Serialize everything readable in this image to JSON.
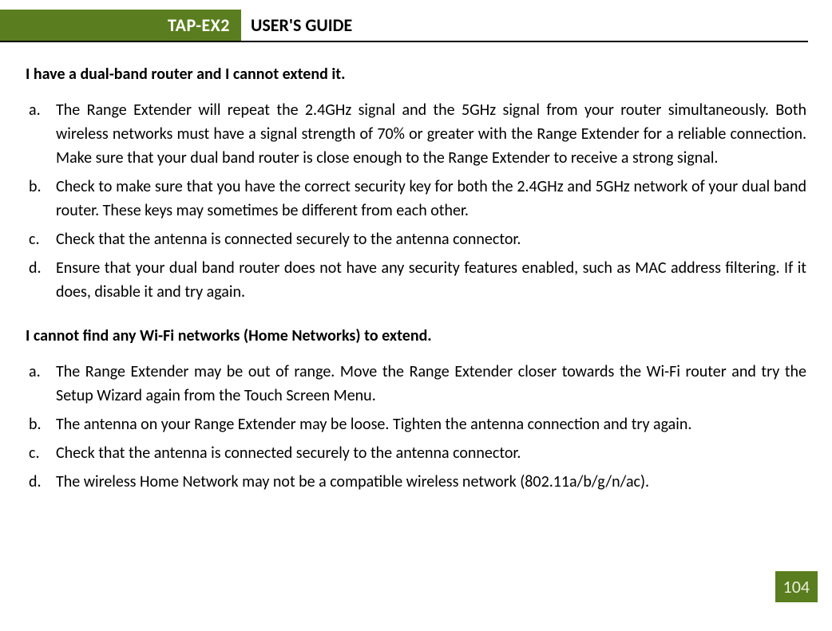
{
  "header": {
    "product": "TAP-EX2",
    "title": "USER'S GUIDE"
  },
  "sections": [
    {
      "heading": "I have a dual-band router and I cannot extend it.",
      "items": [
        {
          "marker": "a.",
          "text": "The Range Extender will repeat the 2.4GHz signal and the 5GHz signal from your router simultaneously. Both wireless networks must have a signal strength of 70% or greater with the Range Extender for a reliable connection. Make sure that your dual band router is close enough to the Range Extender to receive a strong signal."
        },
        {
          "marker": "b.",
          "text": "Check to make sure that you have the correct security key for both the 2.4GHz and 5GHz network of your dual band router. These keys may sometimes be different from each other."
        },
        {
          "marker": "c.",
          "text": "Check that the antenna is connected securely to the antenna connector."
        },
        {
          "marker": "d.",
          "text": "Ensure that your dual band router does not have any security features enabled, such as MAC address filtering. If it does, disable it and try again."
        }
      ]
    },
    {
      "heading": "I cannot find any Wi-Fi networks (Home Networks) to extend.",
      "items": [
        {
          "marker": "a.",
          "text": "The Range Extender may be out of range. Move the Range Extender closer towards the Wi-Fi router and try the Setup Wizard again from the Touch Screen Menu."
        },
        {
          "marker": "b.",
          "text": "The antenna on your Range Extender may be loose. Tighten the antenna connection and try again."
        },
        {
          "marker": "c.",
          "text": "Check that the antenna is connected securely to the antenna connector."
        },
        {
          "marker": "d.",
          "text": "The wireless Home Network may not be a compatible wireless network (802.11a/b/g/n/ac)."
        }
      ]
    }
  ],
  "page_number": "104"
}
